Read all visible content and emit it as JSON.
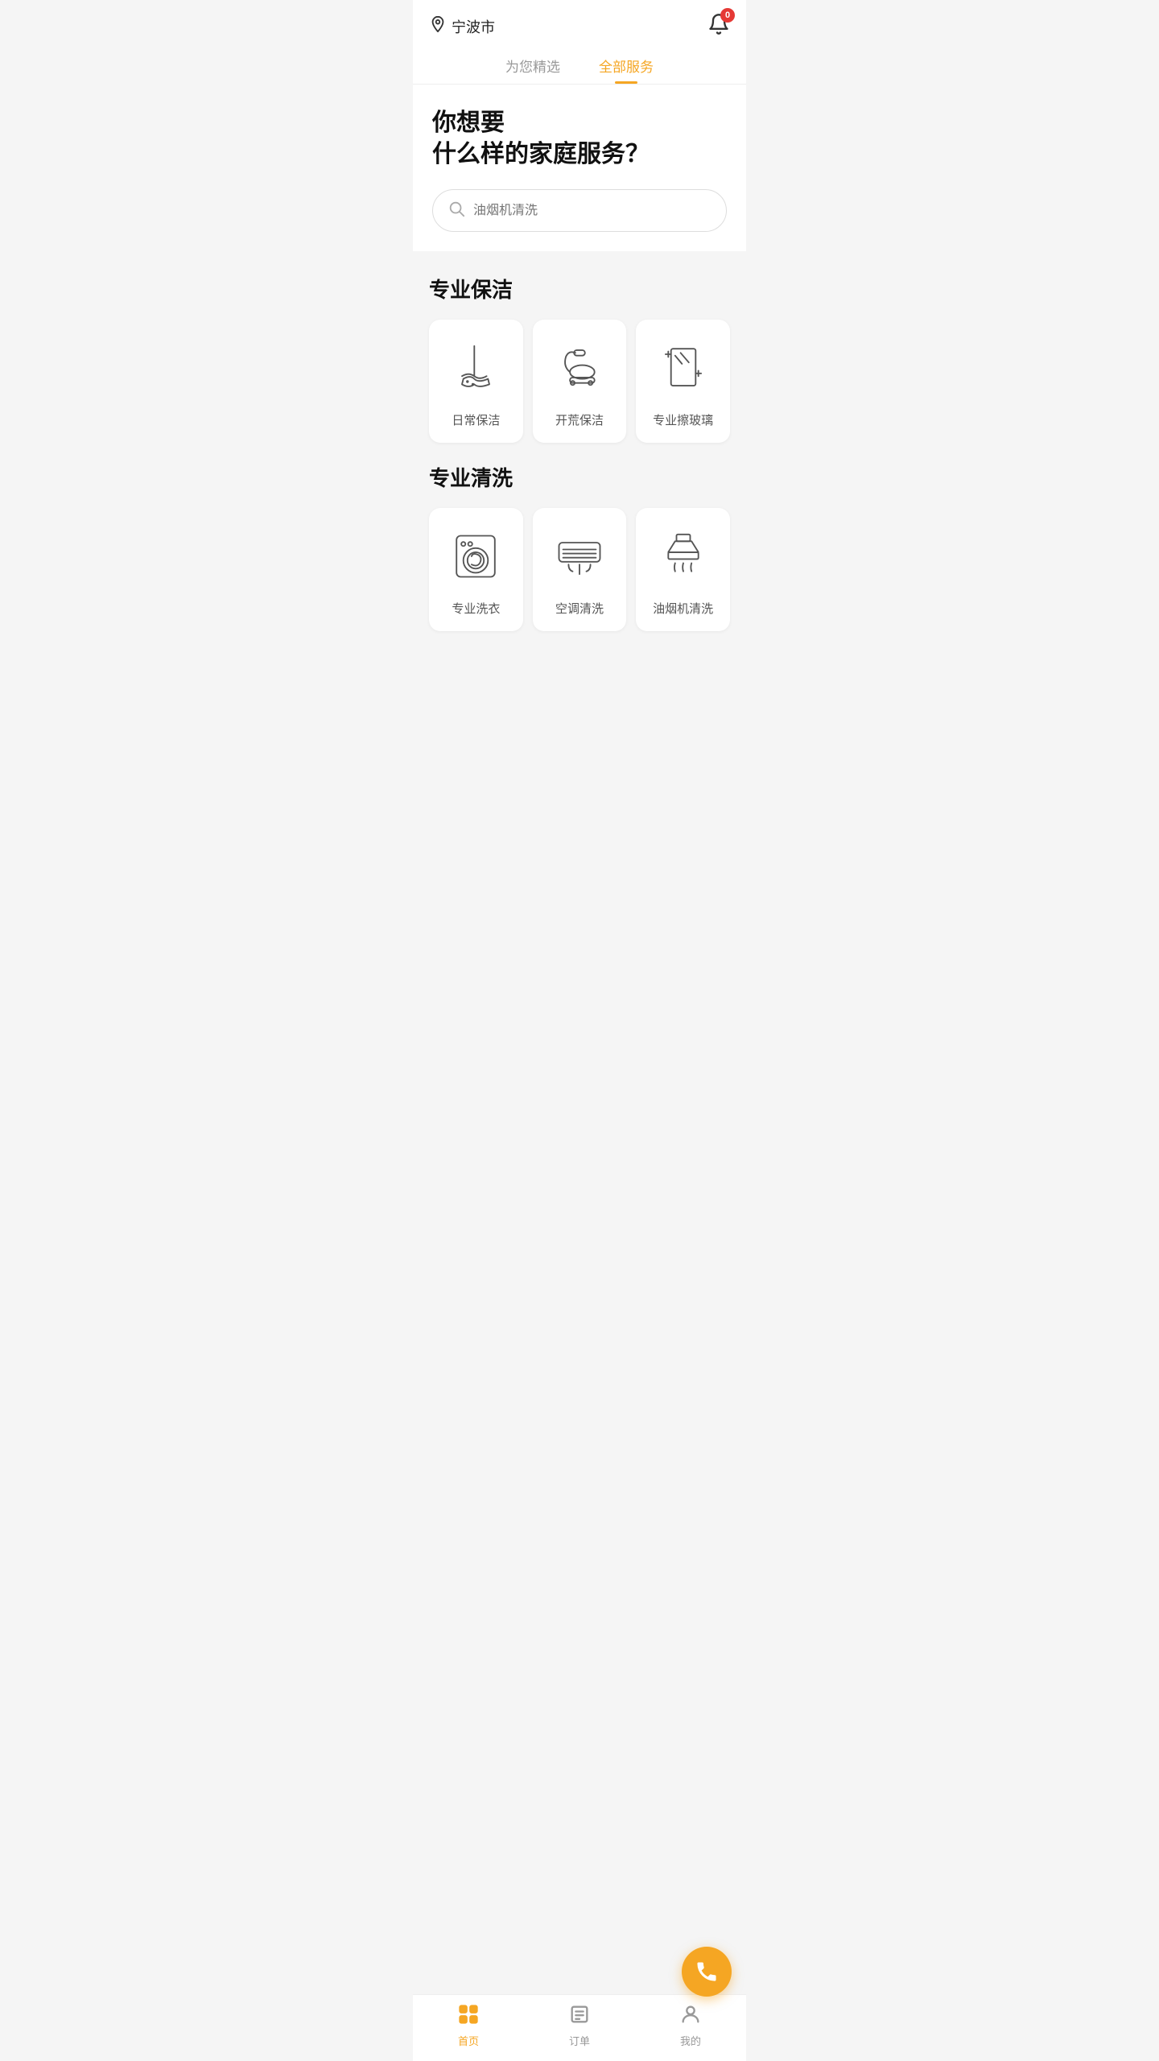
{
  "header": {
    "location": "宁波市",
    "notification_badge": "0"
  },
  "tabs": [
    {
      "id": "recommended",
      "label": "为您精选",
      "active": false
    },
    {
      "id": "all",
      "label": "全部服务",
      "active": true
    }
  ],
  "hero": {
    "title_line1": "你想要",
    "title_line2": "什么样的家庭服务？",
    "search_placeholder": "油烟机清洗"
  },
  "sections": [
    {
      "id": "cleaning",
      "title": "专业保洁",
      "services": [
        {
          "id": "daily-clean",
          "label": "日常保洁",
          "icon": "broom"
        },
        {
          "id": "deep-clean",
          "label": "开荒保洁",
          "icon": "vacuum"
        },
        {
          "id": "window-clean",
          "label": "专业擦玻璃",
          "icon": "window"
        }
      ]
    },
    {
      "id": "washing",
      "title": "专业清洗",
      "services": [
        {
          "id": "laundry",
          "label": "专业洗衣",
          "icon": "washer"
        },
        {
          "id": "ac-clean",
          "label": "空调清洗",
          "icon": "ac"
        },
        {
          "id": "hood-clean",
          "label": "油烟机清洗",
          "icon": "hood"
        }
      ]
    }
  ],
  "bottom_nav": [
    {
      "id": "home",
      "label": "首页",
      "icon": "home",
      "active": true
    },
    {
      "id": "orders",
      "label": "订单",
      "icon": "orders",
      "active": false
    },
    {
      "id": "mine",
      "label": "我的",
      "icon": "profile",
      "active": false
    }
  ],
  "fab": {
    "label": "拨打电话"
  }
}
